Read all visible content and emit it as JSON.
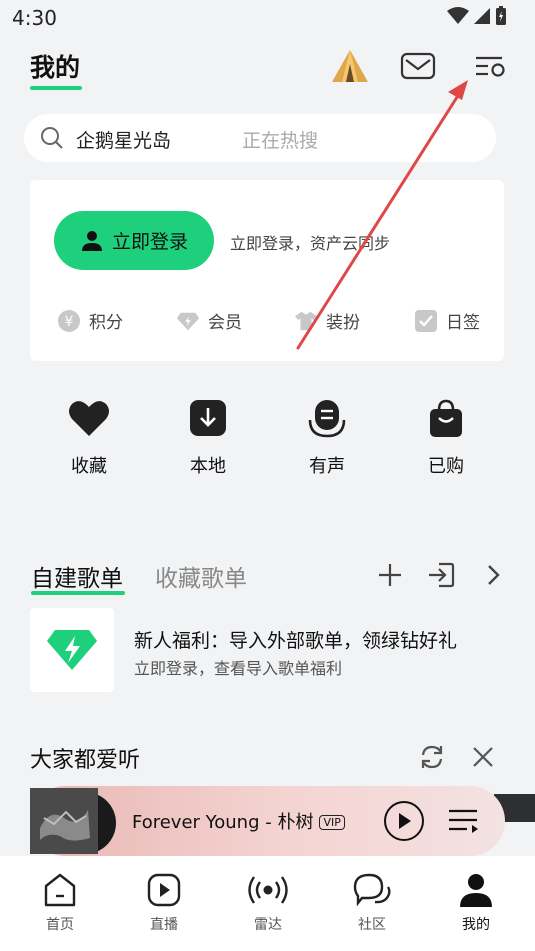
{
  "status": {
    "time": "4:30"
  },
  "header": {
    "tab_mine": "我的"
  },
  "search": {
    "text": "企鹅星光岛",
    "hint": "正在热搜"
  },
  "login_card": {
    "button_label": "立即登录",
    "description": "立即登录，资产云同步",
    "items": [
      {
        "label": "积分",
        "icon": "yuan-coin-icon"
      },
      {
        "label": "会员",
        "icon": "diamond-icon"
      },
      {
        "label": "装扮",
        "icon": "tshirt-icon"
      },
      {
        "label": "日签",
        "icon": "check-square-icon"
      }
    ]
  },
  "quick_actions": [
    {
      "label": "收藏",
      "icon": "heart-icon"
    },
    {
      "label": "本地",
      "icon": "download-icon"
    },
    {
      "label": "有声",
      "icon": "microphone-icon"
    },
    {
      "label": "已购",
      "icon": "shopping-bag-icon"
    }
  ],
  "playlists": {
    "tab_created": "自建歌单",
    "tab_collected": "收藏歌单"
  },
  "promo": {
    "title": "新人福利：导入外部歌单，领绿钻好礼",
    "subtitle": "立即登录，查看导入歌单福利"
  },
  "recommend": {
    "title": "大家都爱听"
  },
  "player": {
    "title": "Forever Young - 朴树",
    "badge": "VIP"
  },
  "bottom_nav": [
    {
      "label": "首页",
      "icon": "home-icon"
    },
    {
      "label": "直播",
      "icon": "live-play-icon"
    },
    {
      "label": "雷达",
      "icon": "radar-icon"
    },
    {
      "label": "社区",
      "icon": "community-chat-icon"
    },
    {
      "label": "我的",
      "icon": "profile-icon",
      "active": true
    }
  ],
  "colors": {
    "accent": "#1ed07c",
    "annotation_arrow": "#e04848"
  }
}
